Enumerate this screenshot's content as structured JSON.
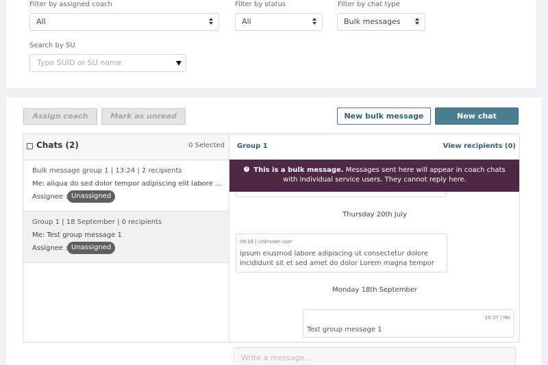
{
  "filters": {
    "coach": {
      "label": "Filter by assigned coach",
      "value": "All"
    },
    "status": {
      "label": "Filter by status",
      "value": "All"
    },
    "chat_type": {
      "label": "Filter by chat type",
      "value": "Bulk messages"
    },
    "search": {
      "label": "Search by SU",
      "placeholder": "Type SUID or SU name"
    }
  },
  "toolbar": {
    "assign_coach": "Assign coach",
    "mark_unread": "Mark as unread",
    "new_bulk": "New bulk message",
    "new_chat": "New chat"
  },
  "chat_list": {
    "title": "Chats (2)",
    "selected": "0 Selected",
    "assignee_label": "Assignee :",
    "items": [
      {
        "header": "Bulk message group 1 | 13:24 | 2 recipients",
        "preview": "Me: aliqua do sed dolor tempor adipiscing elit labore ut sit amet",
        "assignee": "Unassigned"
      },
      {
        "header": "Group 1 | 18 September | 0 recipients",
        "preview": "Me: Test group message 1",
        "assignee": "Unassigned"
      }
    ]
  },
  "conversation": {
    "name": "Group 1",
    "view_recipients": "View recipients (0)",
    "banner": {
      "bold": "This is a bulk message.",
      "text": "Messages sent here will appear in coach chats",
      "text2": "with individual service users. They cannot reply here."
    },
    "date1": "Thursday 20th July",
    "msg1": {
      "meta": "09:16 | Unknown user",
      "line1": "ipsum eiusmod labore adipiscing ut consectetur dolore",
      "line2": "incididunt sit et sed amet do dolor Lorem magna tempor"
    },
    "date2": "Monday 18th September",
    "msg2": {
      "meta": "10:37 | Me",
      "text": "Test group message 1"
    },
    "composer_placeholder": "Write a message..."
  },
  "colors": {
    "accent": "#4a7e91",
    "banner": "#4f2845",
    "pill": "#5e5e5e"
  }
}
